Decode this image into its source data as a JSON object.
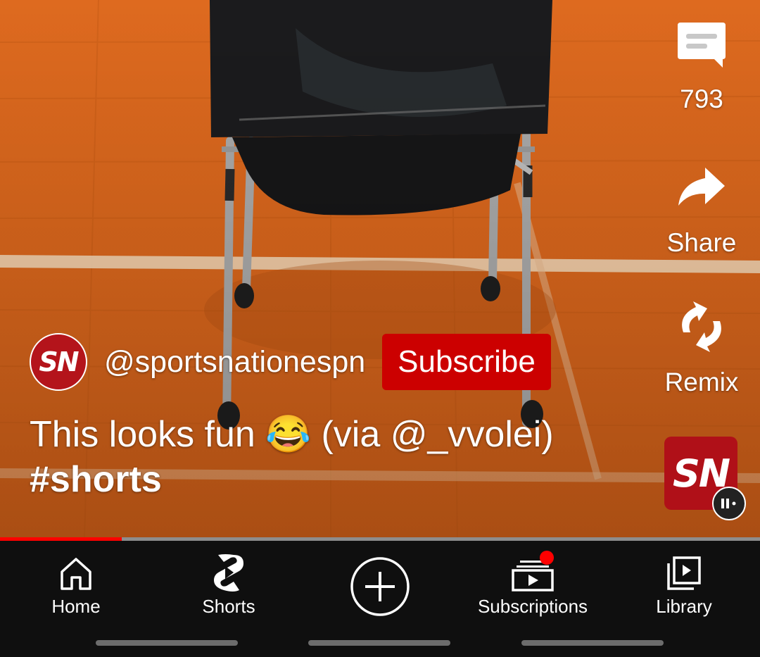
{
  "rail": {
    "comments_count": "793",
    "share_label": "Share",
    "remix_label": "Remix"
  },
  "channel": {
    "avatar_text": "SN",
    "handle": "@sportsnationespn",
    "subscribe_label": "Subscribe"
  },
  "caption": {
    "text": "This looks fun 😂 (via @_vvolei)",
    "hashtag": "#shorts"
  },
  "sound_thumb": {
    "text": "SN"
  },
  "progress": {
    "played_fraction": 0.16
  },
  "nav": {
    "items": [
      {
        "label": "Home",
        "icon": "home-icon"
      },
      {
        "label": "Shorts",
        "icon": "shorts-icon"
      },
      {
        "label": "",
        "icon": "create-plus-icon"
      },
      {
        "label": "Subscriptions",
        "icon": "subscriptions-icon"
      },
      {
        "label": "Library",
        "icon": "library-icon"
      }
    ]
  },
  "colors": {
    "accent": "#ff0000",
    "subscribe_bg": "#cc0000",
    "navbar_bg": "#0f0f0f",
    "court": "#d9661c"
  }
}
